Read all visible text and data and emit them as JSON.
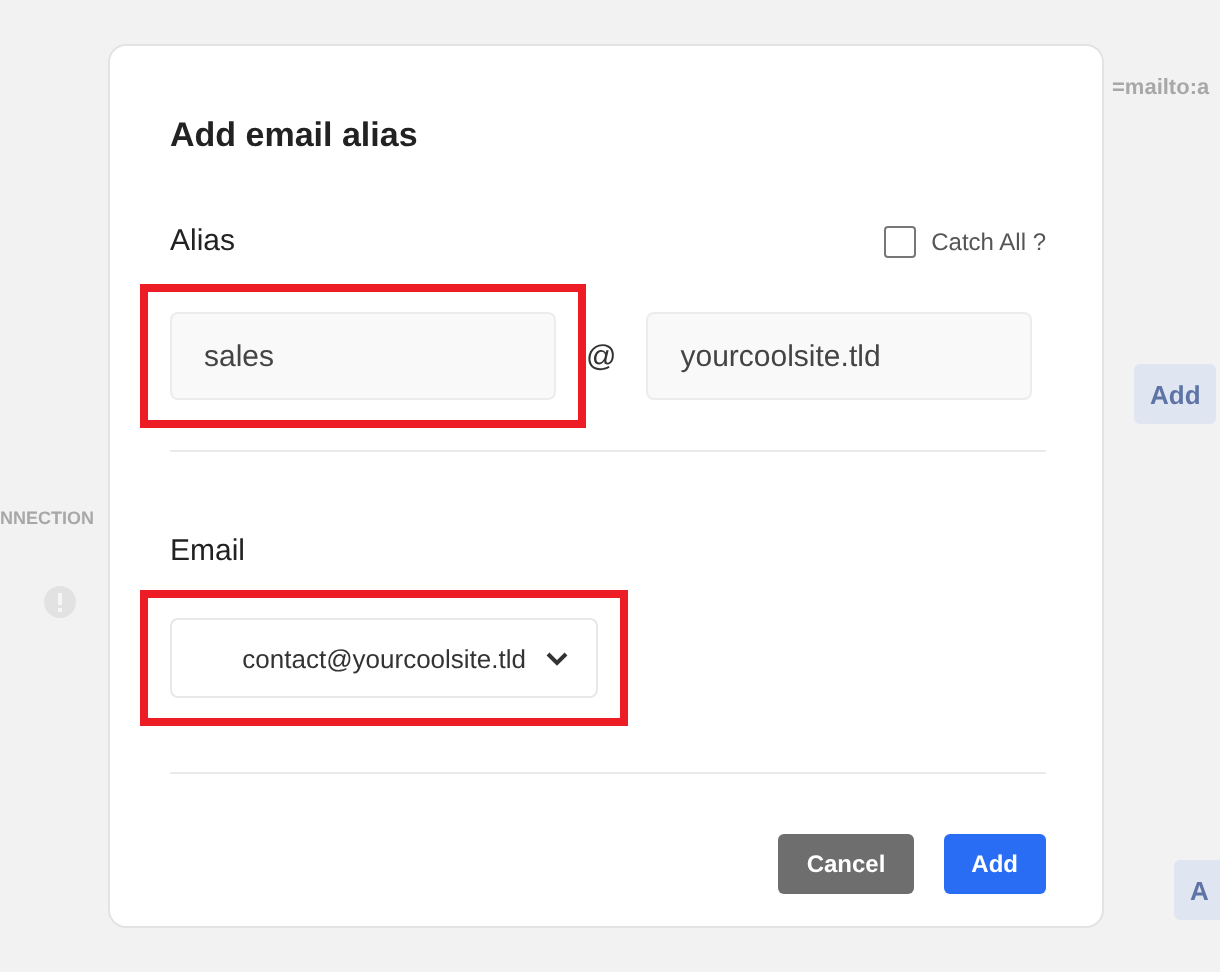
{
  "background": {
    "top_text": "=mailto:a",
    "side_label": "NNECTION",
    "add_button": "Add",
    "bottom_button": "A"
  },
  "dialog": {
    "title": "Add email alias",
    "alias": {
      "label": "Alias",
      "value": "sales",
      "separator": "@",
      "domain": "yourcoolsite.tld",
      "highlighted": true
    },
    "catch_all": {
      "label": "Catch All ?",
      "checked": false
    },
    "email": {
      "label": "Email",
      "value": "contact@yourcoolsite.tld",
      "highlighted": true
    },
    "buttons": [
      {
        "label": "Cancel",
        "kind": "secondary"
      },
      {
        "label": "Add",
        "kind": "primary"
      }
    ]
  }
}
